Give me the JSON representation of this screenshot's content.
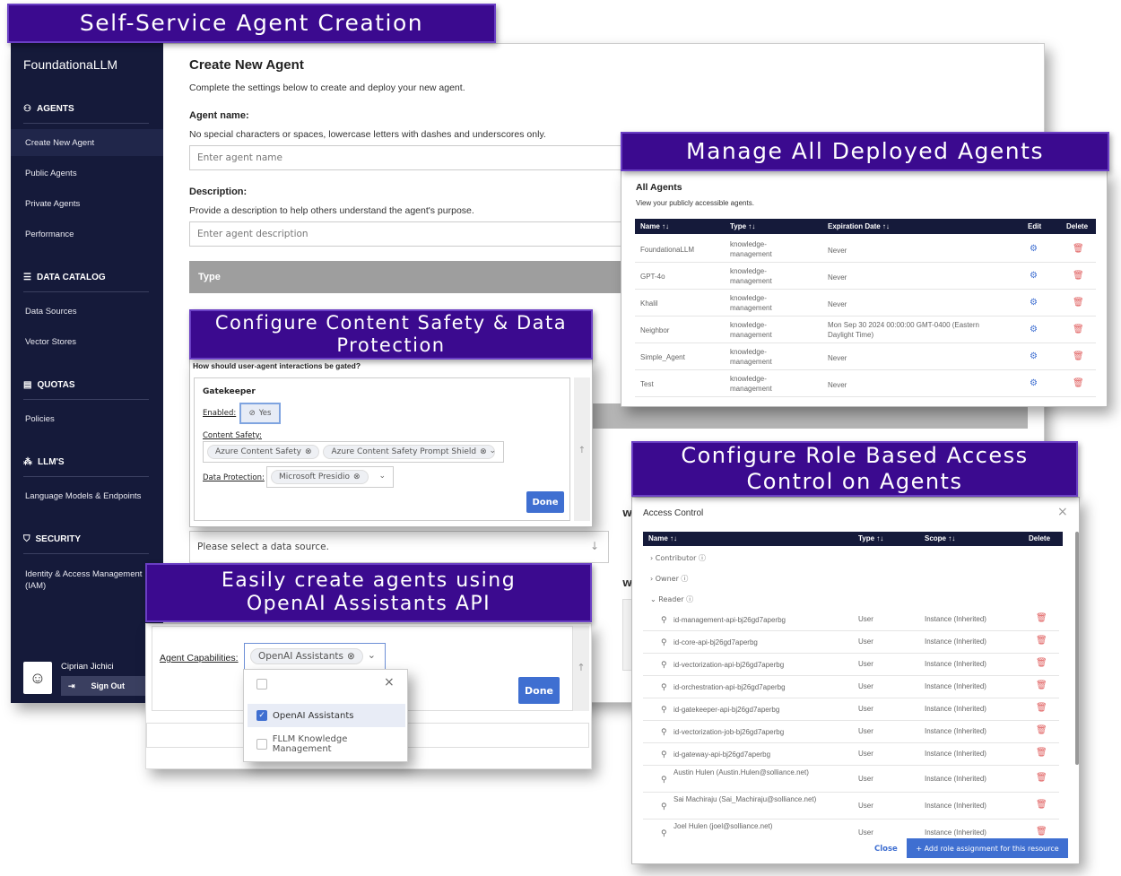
{
  "banners": {
    "self_service": "Self-Service Agent Creation",
    "manage": "Manage All Deployed Agents",
    "content_safety": "Configure Content Safety & Data Protection",
    "rbac": "Configure Role Based Access Control on Agents",
    "openai": "Easily create agents using OpenAI Assistants API"
  },
  "sidebar": {
    "logo": "FoundationaLLM",
    "sections": [
      {
        "title": "AGENTS",
        "items": [
          "Create New Agent",
          "Public Agents",
          "Private Agents",
          "Performance"
        ]
      },
      {
        "title": "DATA CATALOG",
        "items": [
          "Data Sources",
          "Vector Stores"
        ]
      },
      {
        "title": "QUOTAS",
        "items": [
          "Policies"
        ]
      },
      {
        "title": "LLM'S",
        "items": [
          "Language Models & Endpoints"
        ]
      },
      {
        "title": "SECURITY",
        "items": [
          "Identity & Access Management (IAM)"
        ]
      }
    ],
    "user_name": "Ciprian Jichici",
    "sign_out": "Sign Out"
  },
  "create_agent": {
    "title": "Create New Agent",
    "subtitle": "Complete the settings below to create and deploy your new agent.",
    "name_label": "Agent name:",
    "name_help": "No special characters or spaces, lowercase letters with dashes and underscores only.",
    "name_placeholder": "Enter agent name",
    "desc_label": "Description:",
    "desc_help": "Provide a description to help others understand the agent's purpose.",
    "desc_placeholder": "Enter agent description",
    "type_header": "Type",
    "data_source_placeholder": "Please select a data source.",
    "w_marker": "W"
  },
  "all_agents": {
    "title": "All Agents",
    "subtitle": "View your publicly accessible agents.",
    "columns": [
      "Name ↑↓",
      "Type ↑↓",
      "Expiration Date ↑↓",
      "Edit",
      "Delete"
    ],
    "rows": [
      {
        "name": "FoundationaLLM",
        "type": "knowledge-management",
        "exp": "Never"
      },
      {
        "name": "GPT-4o",
        "type": "knowledge-management",
        "exp": "Never"
      },
      {
        "name": "Khalil",
        "type": "knowledge-management",
        "exp": "Never"
      },
      {
        "name": "Neighbor",
        "type": "knowledge-management",
        "exp": "Mon Sep 30 2024 00:00:00 GMT-0400 (Eastern Daylight Time)"
      },
      {
        "name": "Simple_Agent",
        "type": "knowledge-management",
        "exp": "Never"
      },
      {
        "name": "Test",
        "type": "knowledge-management",
        "exp": "Never"
      }
    ]
  },
  "gatekeeper": {
    "question": "How should user-agent interactions be gated?",
    "title": "Gatekeeper",
    "enabled_label": "Enabled:",
    "enabled_value": "Yes",
    "content_safety_label": "Content Safety:",
    "content_safety_chips": [
      "Azure Content Safety",
      "Azure Content Safety Prompt Shield"
    ],
    "data_protection_label": "Data Protection:",
    "data_protection_chips": [
      "Microsoft Presidio"
    ],
    "done": "Done"
  },
  "capabilities": {
    "label": "Agent Capabilities:",
    "chip": "OpenAI Assistants",
    "options": [
      "OpenAI Assistants",
      "FLLM Knowledge Management"
    ],
    "done": "Done"
  },
  "access_control": {
    "title": "Access Control",
    "columns": [
      "Name ↑↓",
      "Type ↑↓",
      "Scope ↑↓",
      "Delete"
    ],
    "groups": [
      "Contributor",
      "Owner",
      "Reader"
    ],
    "rows": [
      {
        "name": "id-management-api-bj26gd7aperbg",
        "type": "User",
        "scope": "Instance (Inherited)"
      },
      {
        "name": "id-core-api-bj26gd7aperbg",
        "type": "User",
        "scope": "Instance (Inherited)"
      },
      {
        "name": "id-vectorization-api-bj26gd7aperbg",
        "type": "User",
        "scope": "Instance (Inherited)"
      },
      {
        "name": "id-orchestration-api-bj26gd7aperbg",
        "type": "User",
        "scope": "Instance (Inherited)"
      },
      {
        "name": "id-gatekeeper-api-bj26gd7aperbg",
        "type": "User",
        "scope": "Instance (Inherited)"
      },
      {
        "name": "id-vectorization-job-bj26gd7aperbg",
        "type": "User",
        "scope": "Instance (Inherited)"
      },
      {
        "name": "id-gateway-api-bj26gd7aperbg",
        "type": "User",
        "scope": "Instance (Inherited)"
      },
      {
        "name": "Austin Hulen (Austin.Hulen@solliance.net)",
        "type": "User",
        "scope": "Instance (Inherited)"
      },
      {
        "name": "Sai Machiraju (Sai_Machiraju@solliance.net)",
        "type": "User",
        "scope": "Instance (Inherited)"
      },
      {
        "name": "Joel Hulen (joel@solliance.net)",
        "type": "User",
        "scope": "Instance (Inherited)"
      }
    ],
    "close": "Close",
    "add": "+ Add role assignment for this resource"
  },
  "colors": {
    "banner": "#3b0a8f",
    "sidebar": "#151a3a",
    "table_header": "#151a3a",
    "accent": "#3f6fd1",
    "delete": "#e06060"
  }
}
